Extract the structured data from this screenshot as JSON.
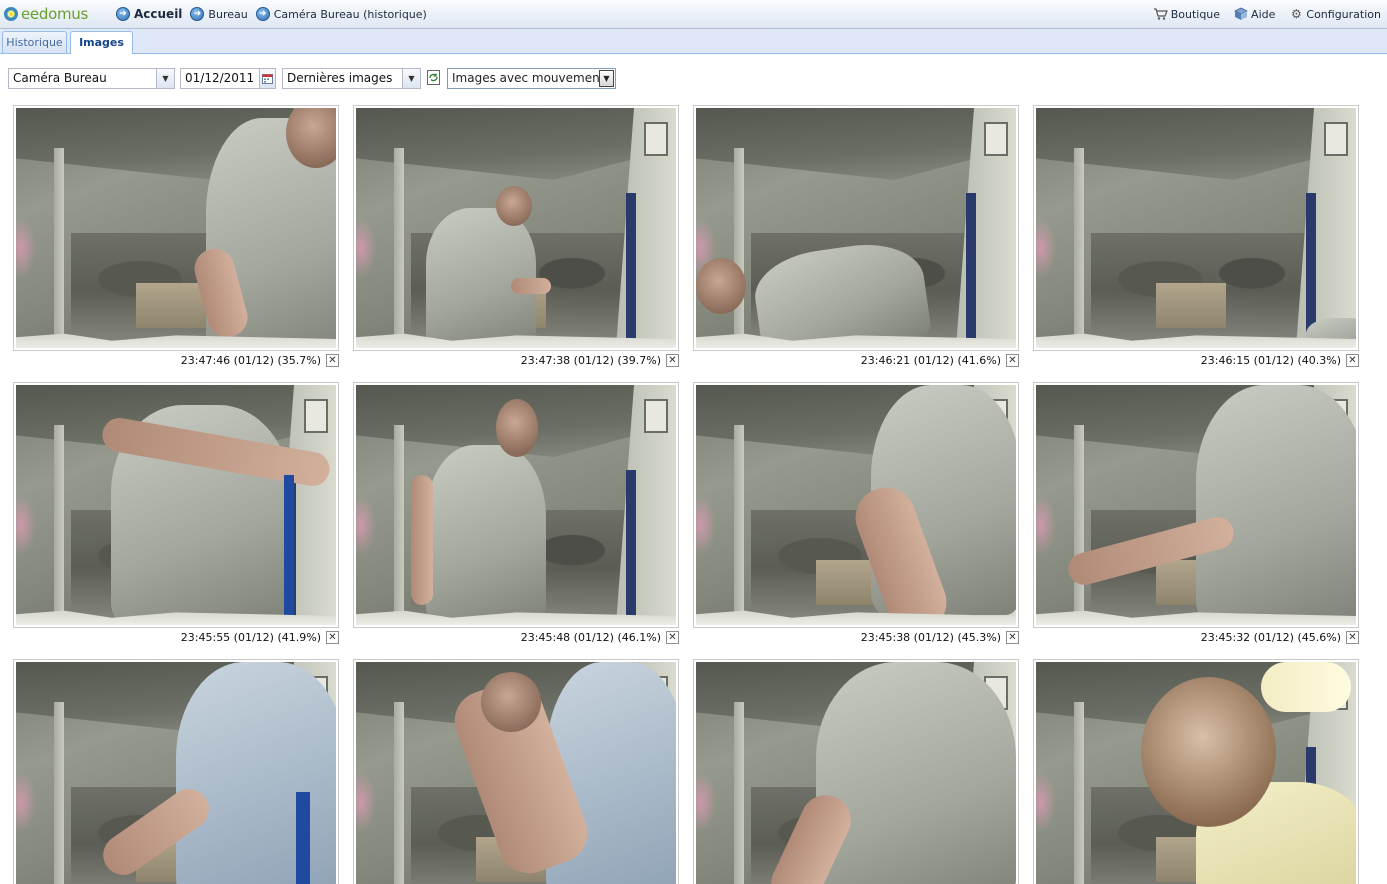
{
  "app": {
    "logo_text": "eedomus"
  },
  "breadcrumb": {
    "items": [
      {
        "label": "Accueil",
        "icon": "arrow-right-circle-icon"
      },
      {
        "label": "Bureau",
        "icon": "arrow-right-circle-icon"
      },
      {
        "label": "Caméra Bureau (historique)",
        "icon": "arrow-right-circle-icon"
      }
    ]
  },
  "right_menu": {
    "shop_label": "Boutique",
    "help_label": "Aide",
    "config_label": "Configuration"
  },
  "tabs": [
    {
      "label": "Historique",
      "active": false
    },
    {
      "label": "Images",
      "active": true
    }
  ],
  "toolbar": {
    "camera_select": "Caméra Bureau",
    "date_value": "01/12/2011",
    "range_select": "Dernières images",
    "filter_select": "Images avec mouvement"
  },
  "images": [
    {
      "caption": "23:47:46 (01/12) (35.7%)",
      "pose": "close-torso"
    },
    {
      "caption": "23:47:38 (01/12) (39.7%)",
      "pose": "standing-back"
    },
    {
      "caption": "23:46:21 (01/12) (41.6%)",
      "pose": "bending"
    },
    {
      "caption": "23:46:15 (01/12) (40.3%)",
      "pose": "empty-corner"
    },
    {
      "caption": "23:45:55 (01/12) (41.9%)",
      "pose": "arm-raised"
    },
    {
      "caption": "23:45:48 (01/12) (46.1%)",
      "pose": "standing-front"
    },
    {
      "caption": "23:45:38 (01/12) (45.3%)",
      "pose": "leaning-right"
    },
    {
      "caption": "23:45:32 (01/12) (45.6%)",
      "pose": "reaching"
    },
    {
      "caption": "",
      "pose": "close-left"
    },
    {
      "caption": "",
      "pose": "fist"
    },
    {
      "caption": "",
      "pose": "close-center"
    },
    {
      "caption": "",
      "pose": "face-closeup"
    }
  ],
  "colors": {
    "accent": "#15428b",
    "tab_border": "#99bbe8",
    "tab_bar_bg": "#dfe8f6"
  }
}
